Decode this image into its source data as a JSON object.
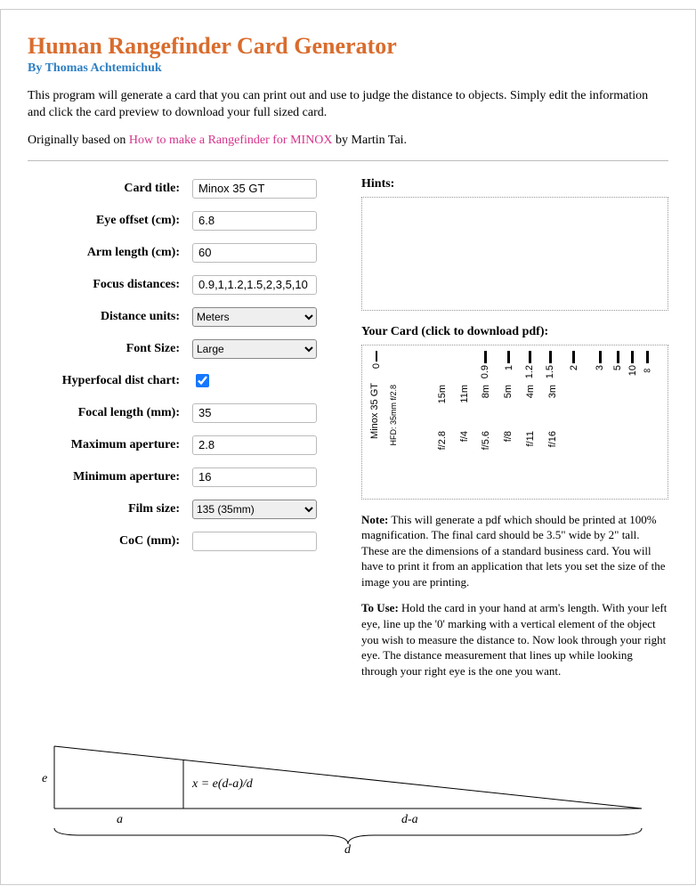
{
  "header": {
    "title": "Human Rangefinder Card Generator",
    "byline": "By Thomas Achtemichuk"
  },
  "intro": {
    "p1": "This program will generate a card that you can print out and use to judge the distance to objects. Simply edit the information and click the card preview to download your full sized card.",
    "p2_pre": "Originally based on ",
    "p2_link": "How to make a Rangefinder for MINOX",
    "p2_post": " by Martin Tai."
  },
  "form": {
    "card_title": {
      "label": "Card title:",
      "value": "Minox 35 GT"
    },
    "eye_offset": {
      "label": "Eye offset (cm):",
      "value": "6.8"
    },
    "arm_length": {
      "label": "Arm length (cm):",
      "value": "60"
    },
    "focus_distances": {
      "label": "Focus distances:",
      "value": "0.9,1,1.2,1.5,2,3,5,10"
    },
    "distance_units": {
      "label": "Distance units:",
      "value": "Meters"
    },
    "font_size": {
      "label": "Font Size:",
      "value": "Large"
    },
    "hyperfocal": {
      "label": "Hyperfocal dist chart:",
      "checked": true
    },
    "focal_length": {
      "label": "Focal length (mm):",
      "value": "35"
    },
    "max_aperture": {
      "label": "Maximum aperture:",
      "value": "2.8"
    },
    "min_aperture": {
      "label": "Minimum aperture:",
      "value": "16"
    },
    "film_size": {
      "label": "Film size:",
      "value": "135 (35mm)"
    },
    "coc": {
      "label": "CoC (mm):",
      "value": ""
    }
  },
  "right": {
    "hints_label": "Hints:",
    "card_label": "Your Card (click to download pdf):",
    "note_label": "Note:",
    "note_text": " This will generate a pdf which should be printed at 100% magnification. The final card should be 3.5\" wide by 2\" tall. These are the dimensions of a standard business card. You will have to print it from an application that lets you set the size of the image you are printing.",
    "use_label": "To Use:",
    "use_text": " Hold the card in your hand at arm's length. With your left eye, line up the '0' marking with a vertical element of the object you wish to measure the distance to. Now look through your right eye. The distance measurement that lines up while looking through your right eye is the one you want."
  },
  "card": {
    "title": "Minox 35 GT",
    "hfd": "HFD: 35mm f/2.8",
    "ticks": [
      {
        "label": "0",
        "left_pct": 3
      },
      {
        "label": "0.9",
        "left_pct": 40
      },
      {
        "label": "1",
        "left_pct": 48
      },
      {
        "label": "1.2",
        "left_pct": 55
      },
      {
        "label": "1.5",
        "left_pct": 62
      },
      {
        "label": "2",
        "left_pct": 70
      },
      {
        "label": "3",
        "left_pct": 79
      },
      {
        "label": "5",
        "left_pct": 85
      },
      {
        "label": "10",
        "left_pct": 90
      },
      {
        "label": "∞",
        "left_pct": 95
      }
    ],
    "fstops": [
      {
        "f": "f/2.8",
        "h": "15m",
        "left_pct": 27
      },
      {
        "f": "f/4",
        "h": "11m",
        "left_pct": 35
      },
      {
        "f": "f/5.6",
        "h": "8m",
        "left_pct": 43
      },
      {
        "f": "f/8",
        "h": "5m",
        "left_pct": 51
      },
      {
        "f": "f/11",
        "h": "4m",
        "left_pct": 59
      },
      {
        "f": "f/16",
        "h": "3m",
        "left_pct": 67
      }
    ]
  },
  "diagram": {
    "e": "e",
    "a": "a",
    "da": "d-a",
    "d": "d",
    "formula": "x = e(d-a)/d"
  },
  "chart_data": {
    "type": "table",
    "title": "Rangefinder card tick marks and hyperfocal distances",
    "focus_distances": [
      0.9,
      1,
      1.2,
      1.5,
      2,
      3,
      5,
      10
    ],
    "distance_unit": "m",
    "hyperfocal": {
      "focal_length_mm": 35,
      "series": [
        {
          "aperture": "f/2.8",
          "distance_m": 15
        },
        {
          "aperture": "f/4",
          "distance_m": 11
        },
        {
          "aperture": "f/5.6",
          "distance_m": 8
        },
        {
          "aperture": "f/8",
          "distance_m": 5
        },
        {
          "aperture": "f/11",
          "distance_m": 4
        },
        {
          "aperture": "f/16",
          "distance_m": 3
        }
      ]
    }
  }
}
